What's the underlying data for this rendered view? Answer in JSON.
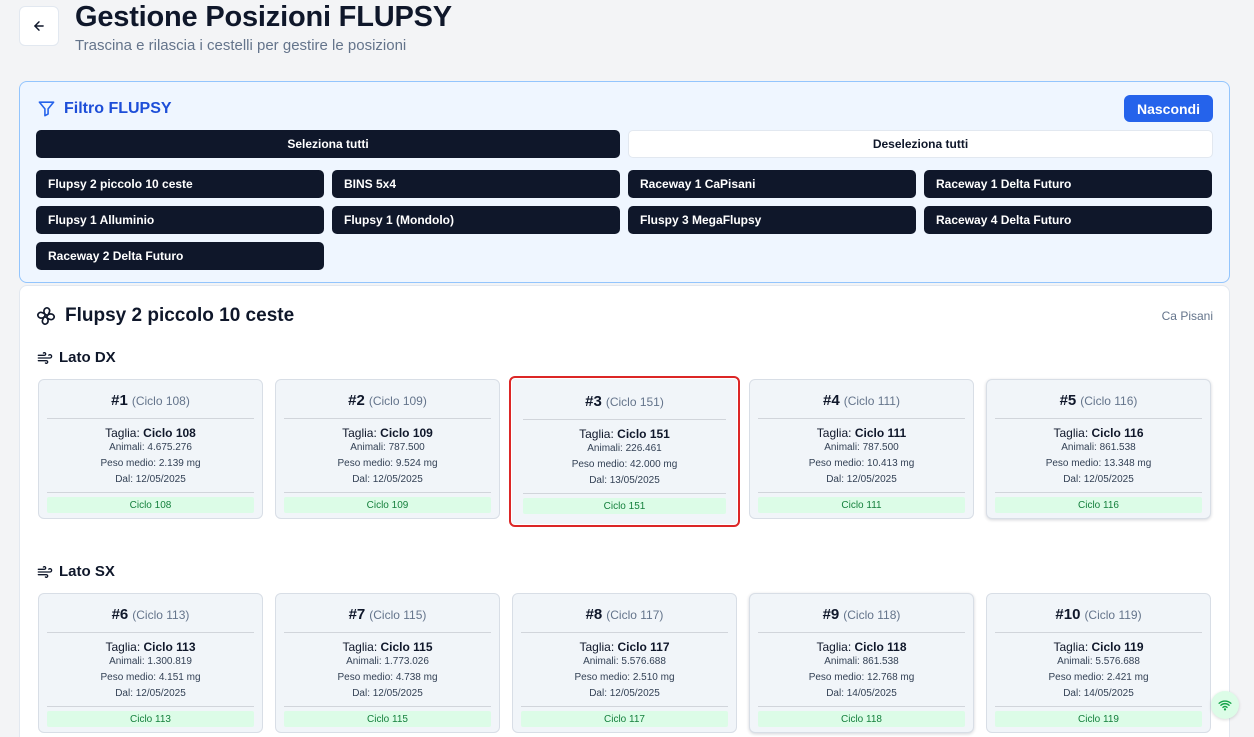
{
  "header": {
    "title": "Gestione Posizioni FLUPSY",
    "subtitle": "Trascina e rilascia i cestelli per gestire le posizioni",
    "back_icon": "arrow-left-icon"
  },
  "filter": {
    "title": "Filtro FLUPSY",
    "hide_label": "Nascondi",
    "select_all_label": "Seleziona tutti",
    "deselect_all_label": "Deseleziona tutti",
    "chips": [
      "Flupsy 2 piccolo 10 ceste",
      "BINS 5x4",
      "Raceway 1 CaPisani",
      "Raceway 1 Delta Futuro",
      "Flupsy 1 Alluminio",
      "Flupsy 1 (Mondolo)",
      "Fluspy 3 MegaFlupsy",
      "Raceway 4 Delta Futuro",
      "Raceway 2 Delta Futuro"
    ]
  },
  "flupsy": {
    "name": "Flupsy 2 piccolo 10 ceste",
    "location": "Ca Pisani",
    "sides": [
      {
        "label": "Lato DX",
        "positions": [
          {
            "num": "#1",
            "cycle": "(Ciclo 108)",
            "taglia_label": "Taglia:",
            "taglia": "Ciclo 108",
            "animali": "Animali: 4.675.276",
            "peso": "Peso medio: 2.139 mg",
            "dal": "Dal: 12/05/2025",
            "badge": "Ciclo 108"
          },
          {
            "num": "#2",
            "cycle": "(Ciclo 109)",
            "taglia_label": "Taglia:",
            "taglia": "Ciclo 109",
            "animali": "Animali: 787.500",
            "peso": "Peso medio: 9.524 mg",
            "dal": "Dal: 12/05/2025",
            "badge": "Ciclo 109"
          },
          {
            "num": "#3",
            "cycle": "(Ciclo 151)",
            "taglia_label": "Taglia:",
            "taglia": "Ciclo 151",
            "animali": "Animali: 226.461",
            "peso": "Peso medio: 42.000 mg",
            "dal": "Dal: 13/05/2025",
            "badge": "Ciclo 151"
          },
          {
            "num": "#4",
            "cycle": "(Ciclo 111)",
            "taglia_label": "Taglia:",
            "taglia": "Ciclo 111",
            "animali": "Animali: 787.500",
            "peso": "Peso medio: 10.413 mg",
            "dal": "Dal: 12/05/2025",
            "badge": "Ciclo 111"
          },
          {
            "num": "#5",
            "cycle": "(Ciclo 116)",
            "taglia_label": "Taglia:",
            "taglia": "Ciclo 116",
            "animali": "Animali: 861.538",
            "peso": "Peso medio: 13.348 mg",
            "dal": "Dal: 12/05/2025",
            "badge": "Ciclo 116"
          }
        ]
      },
      {
        "label": "Lato SX",
        "positions": [
          {
            "num": "#6",
            "cycle": "(Ciclo 113)",
            "taglia_label": "Taglia:",
            "taglia": "Ciclo 113",
            "animali": "Animali: 1.300.819",
            "peso": "Peso medio: 4.151 mg",
            "dal": "Dal: 12/05/2025",
            "badge": "Ciclo 113"
          },
          {
            "num": "#7",
            "cycle": "(Ciclo 115)",
            "taglia_label": "Taglia:",
            "taglia": "Ciclo 115",
            "animali": "Animali: 1.773.026",
            "peso": "Peso medio: 4.738 mg",
            "dal": "Dal: 12/05/2025",
            "badge": "Ciclo 115"
          },
          {
            "num": "#8",
            "cycle": "(Ciclo 117)",
            "taglia_label": "Taglia:",
            "taglia": "Ciclo 117",
            "animali": "Animali: 5.576.688",
            "peso": "Peso medio: 2.510 mg",
            "dal": "Dal: 12/05/2025",
            "badge": "Ciclo 117"
          },
          {
            "num": "#9",
            "cycle": "(Ciclo 118)",
            "taglia_label": "Taglia:",
            "taglia": "Ciclo 118",
            "animali": "Animali: 861.538",
            "peso": "Peso medio: 12.768 mg",
            "dal": "Dal: 14/05/2025",
            "badge": "Ciclo 118"
          },
          {
            "num": "#10",
            "cycle": "(Ciclo 119)",
            "taglia_label": "Taglia:",
            "taglia": "Ciclo 119",
            "animali": "Animali: 5.576.688",
            "peso": "Peso medio: 2.421 mg",
            "dal": "Dal: 14/05/2025",
            "badge": "Ciclo 119"
          }
        ]
      }
    ]
  },
  "colors": {
    "primary_dark": "#0f172a",
    "accent_blue": "#2563eb",
    "highlight_red": "#dc2626",
    "badge_green": "#dcfce7"
  },
  "status": {
    "connection_icon": "wifi-icon"
  }
}
